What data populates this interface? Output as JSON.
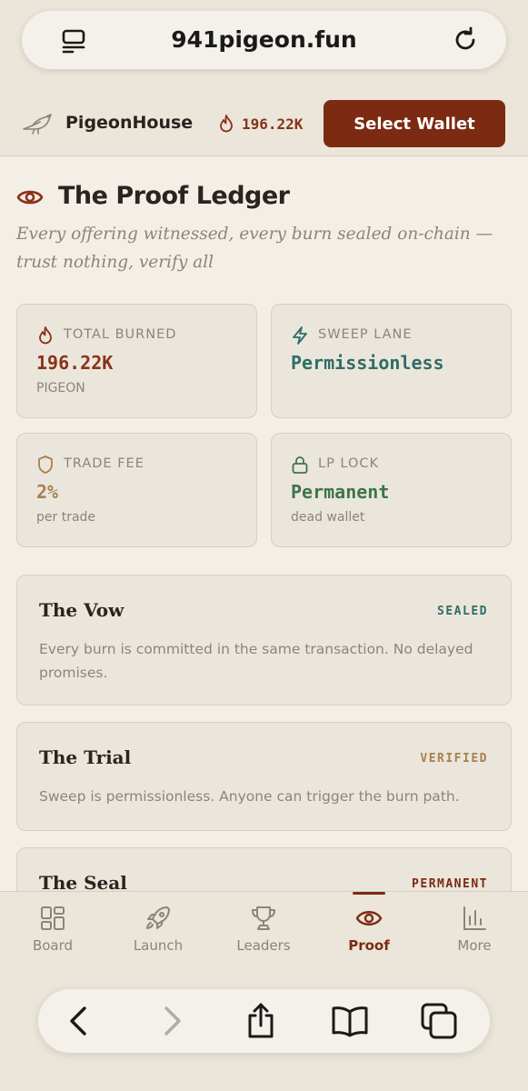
{
  "browser": {
    "url": "941pigeon.fun",
    "tabs_icon": "tabs-icon",
    "reload_icon": "reload-icon",
    "toolbar_icons": [
      "back-icon",
      "forward-icon",
      "share-icon",
      "bookmarks-icon",
      "tabs-overview-icon"
    ]
  },
  "header": {
    "logo_icon": "pigeon-icon",
    "brand": "PigeonHouse",
    "burn_icon": "flame-icon",
    "burn_total": "196.22K",
    "wallet_button": "Select Wallet"
  },
  "page": {
    "title_icon": "eye-icon",
    "title": "The Proof Ledger",
    "subtitle": "Every offering witnessed, every burn sealed on-chain — trust nothing, verify all"
  },
  "stats": [
    {
      "icon": "flame-icon",
      "label": "TOTAL BURNED",
      "value": "196.22K",
      "sub": "PIGEON",
      "color": "#8a3218"
    },
    {
      "icon": "lightning-icon",
      "label": "SWEEP LANE",
      "value": "Permissionless",
      "sub": "",
      "color": "#2e6e66"
    },
    {
      "icon": "shield-icon",
      "label": "TRADE FEE",
      "value": "2%",
      "sub": "per trade",
      "color": "#a88050"
    },
    {
      "icon": "lock-icon",
      "label": "LP LOCK",
      "value": "Permanent",
      "sub": "dead wallet",
      "color": "#3d7548"
    }
  ],
  "cards": [
    {
      "title": "The Vow",
      "badge": "SEALED",
      "badge_color": "#2e6e66",
      "body": "Every burn is committed in the same transaction. No delayed promises."
    },
    {
      "title": "The Trial",
      "badge": "VERIFIED",
      "badge_color": "#a88050",
      "body": "Sweep is permissionless. Anyone can trigger the burn path."
    },
    {
      "title": "The Seal",
      "badge": "PERMANENT",
      "badge_color": "#7c2a12",
      "body": ""
    }
  ],
  "nav": {
    "items": [
      {
        "label": "Board",
        "icon": "grid-icon"
      },
      {
        "label": "Launch",
        "icon": "rocket-icon"
      },
      {
        "label": "Leaders",
        "icon": "trophy-icon"
      },
      {
        "label": "Proof",
        "icon": "eye-icon"
      },
      {
        "label": "More",
        "icon": "bar-chart-icon"
      }
    ],
    "active": "Proof"
  },
  "colors": {
    "accent": "#7c2a12",
    "background": "#f3efe7",
    "card": "#ebe6dc",
    "muted": "#8c847a"
  }
}
